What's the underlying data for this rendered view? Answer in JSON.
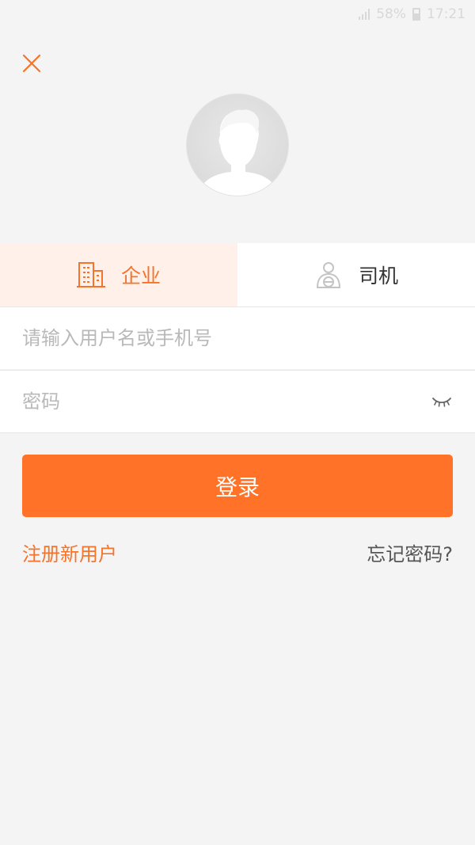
{
  "status_bar": {
    "battery_percent": "58%",
    "time": "17:21"
  },
  "icons": {
    "close": "close-icon",
    "avatar": "default-avatar",
    "company": "building-icon",
    "driver": "driver-icon",
    "password_toggle": "eye-closed-icon"
  },
  "tabs": [
    {
      "label": "企业",
      "active": true
    },
    {
      "label": "司机",
      "active": false
    }
  ],
  "form": {
    "username_placeholder": "请输入用户名或手机号",
    "username_value": "",
    "password_placeholder": "密码",
    "password_value": ""
  },
  "actions": {
    "login_label": "登录",
    "register_label": "注册新用户",
    "forgot_label": "忘记密码?"
  },
  "colors": {
    "accent": "#ff7227",
    "accent_text": "#f5732a",
    "active_tab_bg": "#fff0e9",
    "background": "#f4f4f4"
  }
}
